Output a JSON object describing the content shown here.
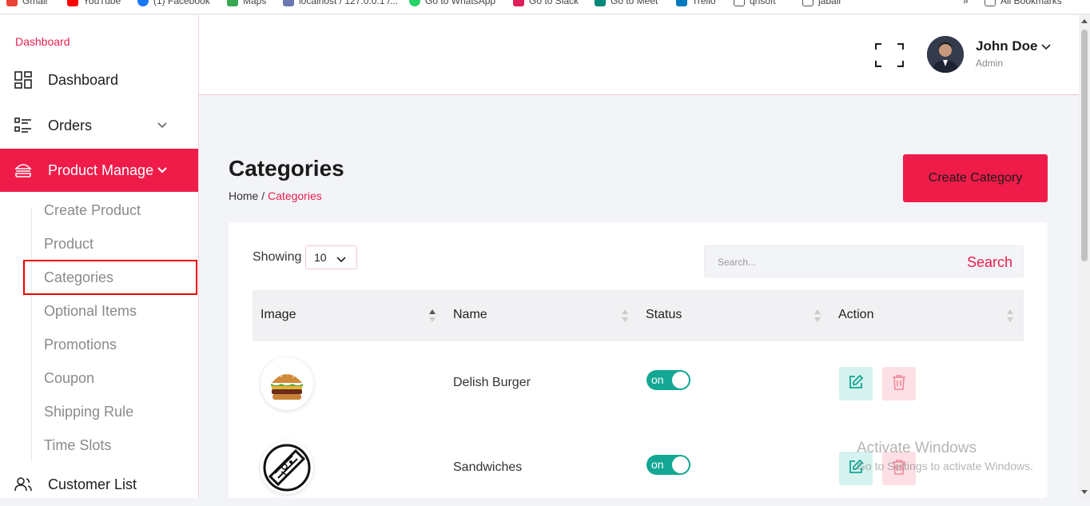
{
  "bookmarks": {
    "items": [
      {
        "label": "Gmail",
        "icon": "gmail-icon"
      },
      {
        "label": "YouTube",
        "icon": "youtube-icon"
      },
      {
        "label": "(1) Facebook",
        "icon": "facebook-icon"
      },
      {
        "label": "Maps",
        "icon": "maps-icon"
      },
      {
        "label": "localhost / 127.0.0.1 /...",
        "icon": "phpmyadmin-icon"
      },
      {
        "label": "Go to WhatsApp",
        "icon": "whatsapp-icon"
      },
      {
        "label": "Go to Slack",
        "icon": "slack-icon"
      },
      {
        "label": "Go to Meet",
        "icon": "meet-icon"
      },
      {
        "label": "Trello",
        "icon": "trello-icon"
      },
      {
        "label": "qnsoft",
        "icon": "folder-icon"
      },
      {
        "label": "jabali",
        "icon": "folder-icon"
      }
    ],
    "more": "»",
    "all_bookmarks": "All Bookmarks"
  },
  "sidebar": {
    "brand": "Dashboard",
    "items": [
      {
        "label": "Dashboard",
        "icon": "grid-icon"
      },
      {
        "label": "Orders",
        "icon": "list-icon"
      },
      {
        "label": "Product Manage",
        "icon": "burger-icon"
      },
      {
        "label": "Customer List",
        "icon": "users-icon"
      }
    ],
    "sub_items": [
      "Create Product",
      "Product",
      "Categories",
      "Optional Items",
      "Promotions",
      "Coupon",
      "Shipping Rule",
      "Time Slots"
    ]
  },
  "header": {
    "user_name": "John Doe",
    "user_role": "Admin"
  },
  "page": {
    "title": "Categories",
    "breadcrumb_home": "Home",
    "breadcrumb_sep": "/",
    "breadcrumb_current": "Categories",
    "create_button": "Create Category"
  },
  "table": {
    "showing_label": "Showing",
    "page_size": "10",
    "search_placeholder": "Search...",
    "search_button": "Search",
    "columns": [
      "Image",
      "Name",
      "Status",
      "Action"
    ],
    "rows": [
      {
        "name": "Delish Burger",
        "status": "on",
        "image": "burger-image"
      },
      {
        "name": "Sandwiches",
        "status": "on",
        "image": "sandwich-image"
      }
    ]
  },
  "watermark": {
    "line1": "Activate Windows",
    "line2": "Go to Settings to activate Windows."
  },
  "colors": {
    "accent": "#ef1c49",
    "toggle_on": "#13a794",
    "edit_bg": "#d6f2ee",
    "delete_bg": "#fde0e5"
  }
}
